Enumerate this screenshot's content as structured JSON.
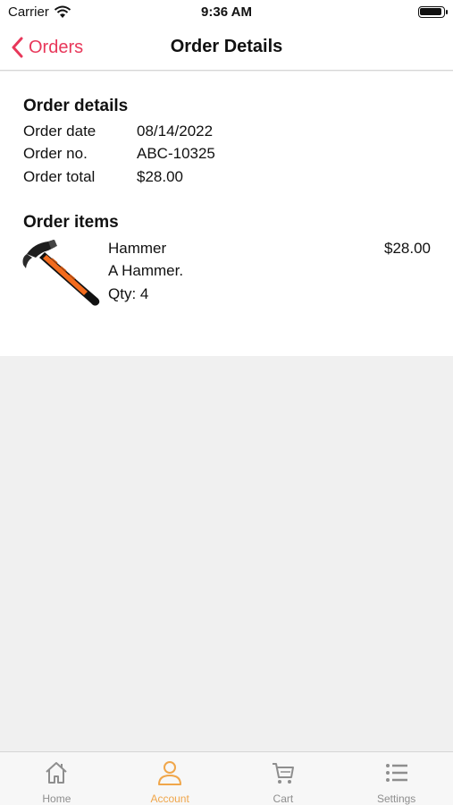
{
  "status_bar": {
    "carrier": "Carrier",
    "time": "9:36 AM"
  },
  "nav": {
    "back_label": "Orders",
    "title": "Order Details"
  },
  "order_details": {
    "heading": "Order details",
    "rows": [
      {
        "label": "Order date",
        "value": "08/14/2022"
      },
      {
        "label": "Order no.",
        "value": "ABC-10325"
      },
      {
        "label": "Order total",
        "value": "$28.00"
      }
    ]
  },
  "order_items": {
    "heading": "Order items",
    "items": [
      {
        "name": "Hammer",
        "description": "A Hammer.",
        "quantity": "Qty: 4",
        "price": "$28.00",
        "image_icon": "hammer-image"
      }
    ]
  },
  "tab_bar": {
    "tabs": [
      {
        "label": "Home",
        "icon": "home-icon",
        "active": false
      },
      {
        "label": "Account",
        "icon": "person-icon",
        "active": true
      },
      {
        "label": "Cart",
        "icon": "cart-icon",
        "active": false
      },
      {
        "label": "Settings",
        "icon": "list-icon",
        "active": false
      }
    ]
  },
  "colors": {
    "accent": "#e8375a",
    "tab_active": "#f0a64a",
    "tab_inactive": "#8e8e8e",
    "background": "#f0f0f0"
  }
}
